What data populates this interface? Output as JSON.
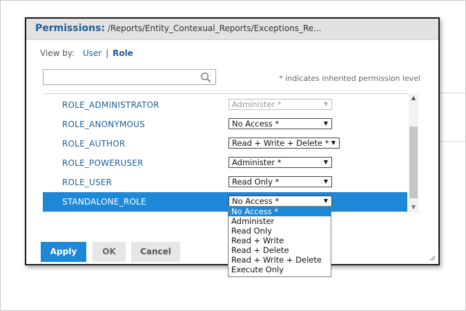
{
  "dialog": {
    "title": "Permissions:",
    "path": "/Reports/Entity_Contexual_Reports/Exceptions_Re..."
  },
  "view_by": {
    "label": "View by:",
    "user": "User",
    "separator": "|",
    "role": "Role"
  },
  "search": {
    "value": "",
    "placeholder": ""
  },
  "note": "* indicates inherited permission level",
  "rows": [
    {
      "name": "ROLE_ADMINISTRATOR",
      "permission": "Administer *"
    },
    {
      "name": "ROLE_ANONYMOUS",
      "permission": "No Access *"
    },
    {
      "name": "ROLE_AUTHOR",
      "permission": "Read + Write + Delete *"
    },
    {
      "name": "ROLE_POWERUSER",
      "permission": "Administer *"
    },
    {
      "name": "ROLE_USER",
      "permission": "Read Only *"
    },
    {
      "name": "STANDALONE_ROLE",
      "permission": "No Access *"
    }
  ],
  "dropdown_options": [
    "No Access *",
    "Administer",
    "Read Only",
    "Read + Write",
    "Read + Delete",
    "Read + Write + Delete",
    "Execute Only"
  ],
  "buttons": {
    "apply": "Apply",
    "ok": "OK",
    "cancel": "Cancel"
  },
  "colors": {
    "accent": "#1e88d8",
    "title": "#1f5f96"
  }
}
